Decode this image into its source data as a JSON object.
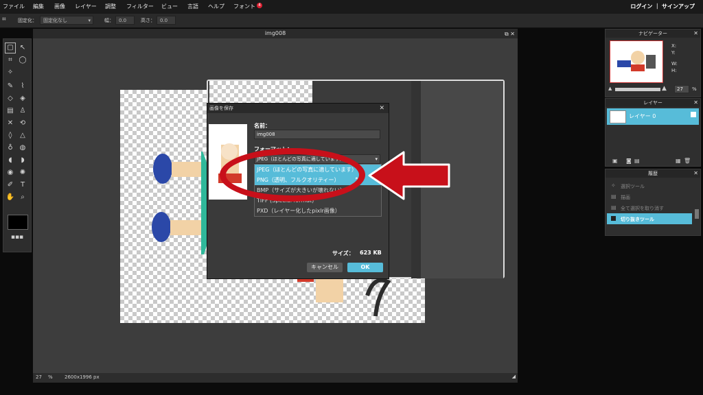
{
  "menu": {
    "items": [
      "ファイル",
      "編集",
      "画像",
      "レイヤー",
      "調整",
      "フィルター",
      "ビュー",
      "言語",
      "ヘルプ",
      "フォント"
    ],
    "font_badge": "4",
    "account": "ログイン ｜ サインアップ"
  },
  "options_bar": {
    "fixed_label": "固定化：",
    "fixed_value": "固定化なし",
    "width_label": "幅：",
    "width_value": "0.0",
    "height_label": "高さ：",
    "height_value": "0.0"
  },
  "document": {
    "title": "img008",
    "zoom": "27",
    "zoom_unit": "%",
    "dimensions": "2600x1996 px"
  },
  "navigator": {
    "title": "ナビゲーター",
    "x_label": "X:",
    "y_label": "Y:",
    "w_label": "W:",
    "h_label": "H:",
    "zoom": "27",
    "zoom_unit": "%"
  },
  "layers": {
    "title": "レイヤー",
    "items": [
      {
        "label": "レイヤー 0"
      }
    ]
  },
  "history": {
    "title": "履歴",
    "items": [
      "選択ツール",
      "描画",
      "全て選択を取り消す",
      "切り抜きツール"
    ]
  },
  "save_dialog": {
    "title": "画像を保存",
    "name_label": "名前：",
    "name_value": "img008",
    "format_label": "フォーマット：",
    "format_selected": "JPEG（ほとんどの写真に適しています）",
    "format_options": [
      "JPEG（ほとんどの写真に適しています）",
      "PNG（透明、フルクオリティー）",
      "BMP（サイズが大きいが壊れない）",
      "TIFF (Special format)",
      "PXD（レイヤー化したpixlr画像）"
    ],
    "size_label": "サイズ：",
    "size_value": "623 KB",
    "cancel": "キャンセル",
    "ok": "OK"
  },
  "colors": {
    "accent": "#57bcd9",
    "annotation_red": "#c8101a"
  }
}
